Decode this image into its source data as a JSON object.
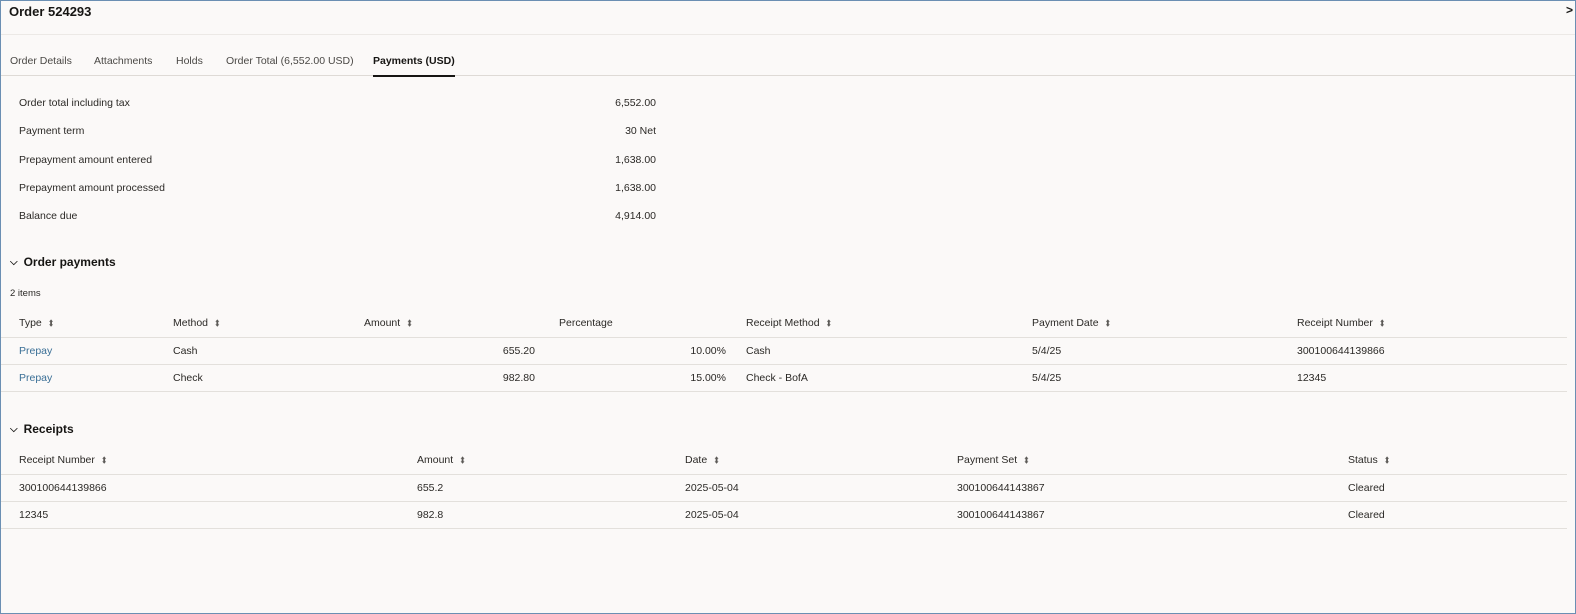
{
  "dialog": {
    "title": "Order 524293",
    "close_label": ">"
  },
  "tabs": [
    {
      "label": "Order Details"
    },
    {
      "label": "Attachments"
    },
    {
      "label": "Holds"
    },
    {
      "label": "Order Total (6,552.00 USD)"
    },
    {
      "label": "Payments (USD)",
      "active": true
    }
  ],
  "summary": [
    {
      "label": "Order total including tax",
      "value": "6,552.00"
    },
    {
      "label": "Payment term",
      "value": "30 Net"
    },
    {
      "label": "Prepayment amount entered",
      "value": "1,638.00"
    },
    {
      "label": "Prepayment amount processed",
      "value": "1,638.00"
    },
    {
      "label": "Balance due",
      "value": "4,914.00"
    }
  ],
  "order_payments": {
    "title": "Order payments",
    "count": "2 items",
    "columns": [
      "Type",
      "Method",
      "Amount",
      "Percentage",
      "Receipt Method",
      "Payment Date",
      "Receipt Number"
    ],
    "rows": [
      {
        "type": "Prepay",
        "method": "Cash",
        "amount": "655.20",
        "percentage": "10.00%",
        "receipt_method": "Cash",
        "payment_date": "5/4/25",
        "receipt_number": "300100644139866"
      },
      {
        "type": "Prepay",
        "method": "Check",
        "amount": "982.80",
        "percentage": "15.00%",
        "receipt_method": "Check - BofA",
        "payment_date": "5/4/25",
        "receipt_number": "12345"
      }
    ]
  },
  "receipts": {
    "title": "Receipts",
    "columns": [
      "Receipt Number",
      "Amount",
      "Date",
      "Payment Set",
      "Status"
    ],
    "rows": [
      {
        "receipt_number": "300100644139866",
        "amount": "655.2",
        "date": "2025-05-04",
        "payment_set": "300100644143867",
        "status": "Cleared"
      },
      {
        "receipt_number": "12345",
        "amount": "982.8",
        "date": "2025-05-04",
        "payment_set": "300100644143867",
        "status": "Cleared"
      }
    ]
  },
  "icons": {
    "sort": "sort-icon",
    "chevron": "chevron-down-icon"
  }
}
